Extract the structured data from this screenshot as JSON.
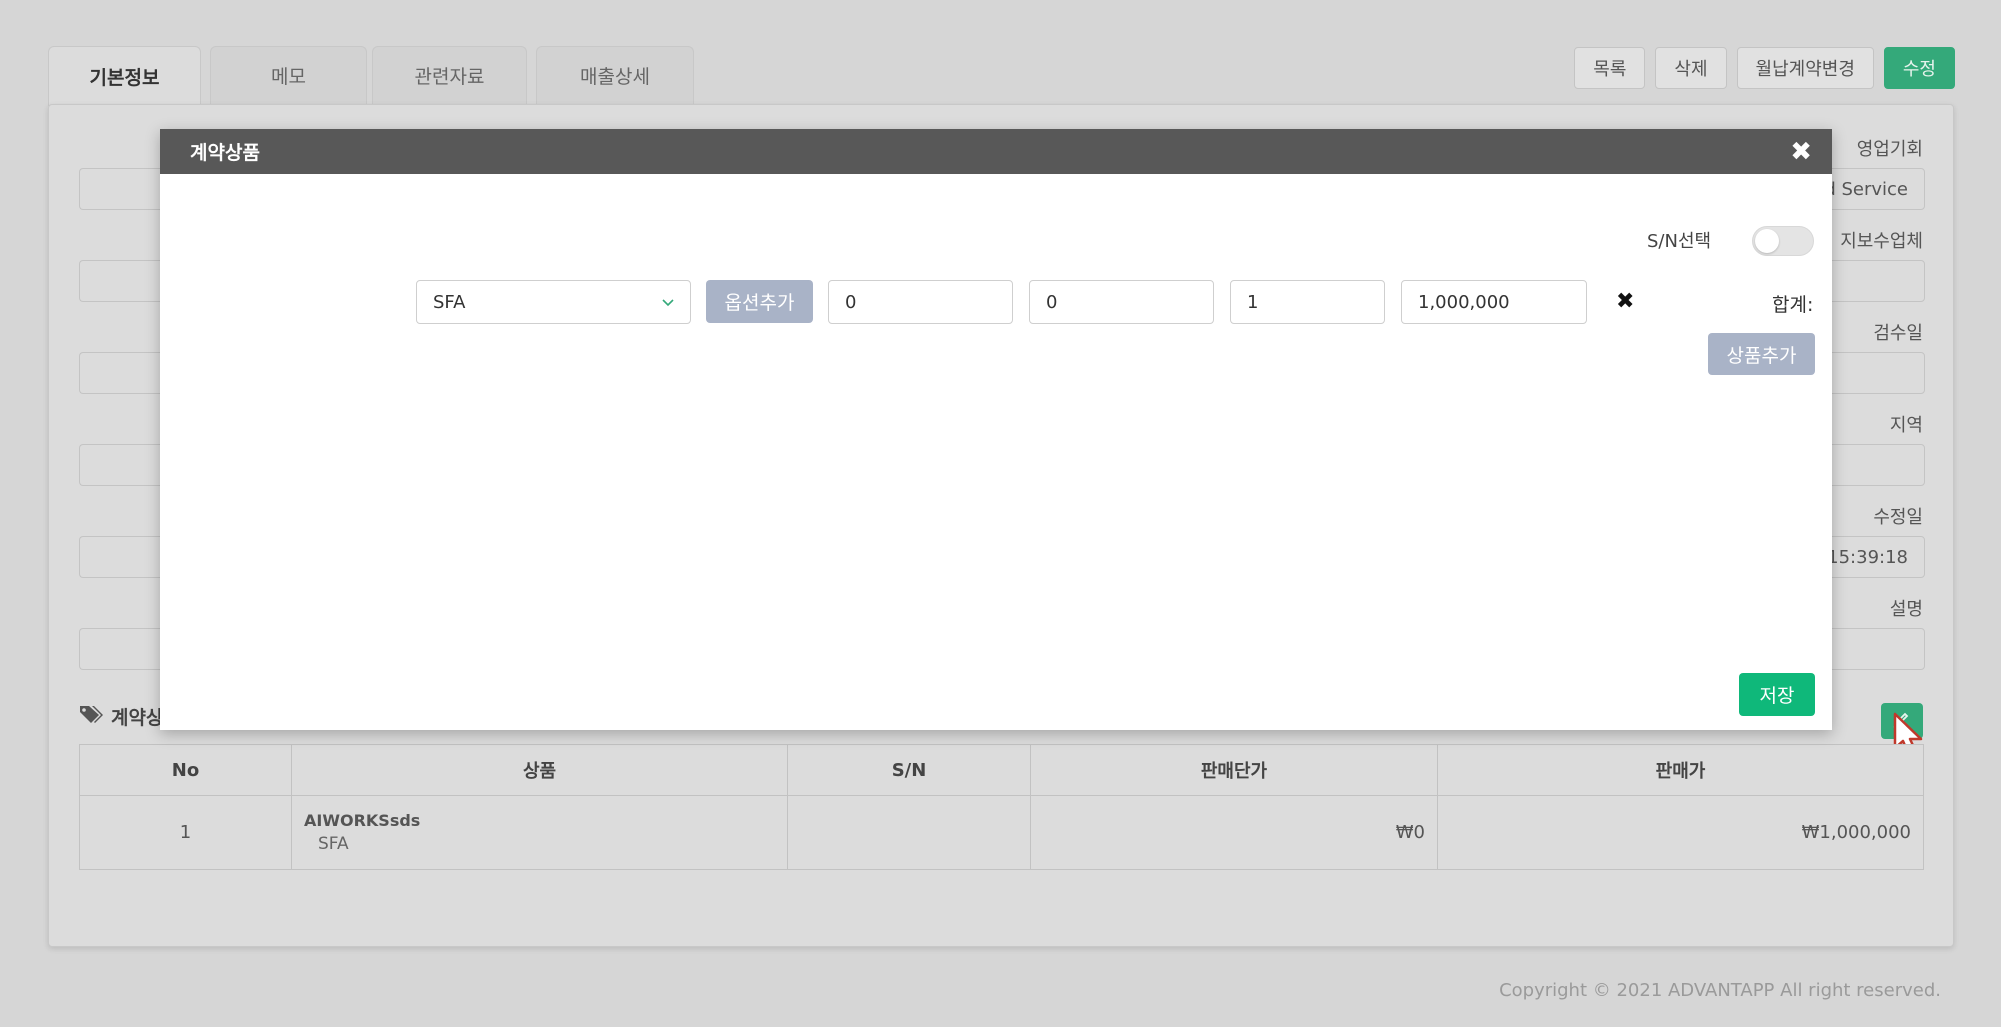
{
  "tabs": [
    "기본정보",
    "메모",
    "관련자료",
    "매출상세"
  ],
  "top_buttons": {
    "list": "목록",
    "delete": "삭제",
    "monthly_change": "월납계약변경",
    "edit": "수정"
  },
  "right_fields": {
    "opportunity_label": "영업기회",
    "opportunity_value": "d Service",
    "maintenance_label": "지보수업체",
    "inspection_label": "검수일",
    "region_label": "지역",
    "modified_label": "수정일",
    "modified_value": "15:39:18",
    "description_label": "설명"
  },
  "section": {
    "title": "계약상"
  },
  "table": {
    "headers": [
      "No",
      "상품",
      "S/N",
      "판매단가",
      "판매가"
    ],
    "rows": [
      {
        "no": "1",
        "product_main": "AIWORKSsds",
        "product_sub": "SFA",
        "sn": "",
        "unit_price": "₩0",
        "price": "₩1,000,000"
      }
    ]
  },
  "footer": "Copyright © 2021 ADVANTAPP All right reserved.",
  "modal": {
    "title": "계약상품",
    "sn_label": "S/N선택",
    "product_select": "SFA",
    "option_button": "옵션추가",
    "inputs": [
      "0",
      "0",
      "1",
      "1,000,000"
    ],
    "sum_label": "합계:",
    "add_product_button": "상품추가",
    "save_button": "저장"
  },
  "colors": {
    "accent_green": "#34a97a",
    "save_green": "#0fb87a",
    "disabled_button": "#a9b3c7",
    "modal_header": "#585858"
  },
  "icons": [
    "tags-icon",
    "pencil-icon",
    "close-icon",
    "chevron-down-icon",
    "cursor-icon",
    "remove-icon"
  ]
}
